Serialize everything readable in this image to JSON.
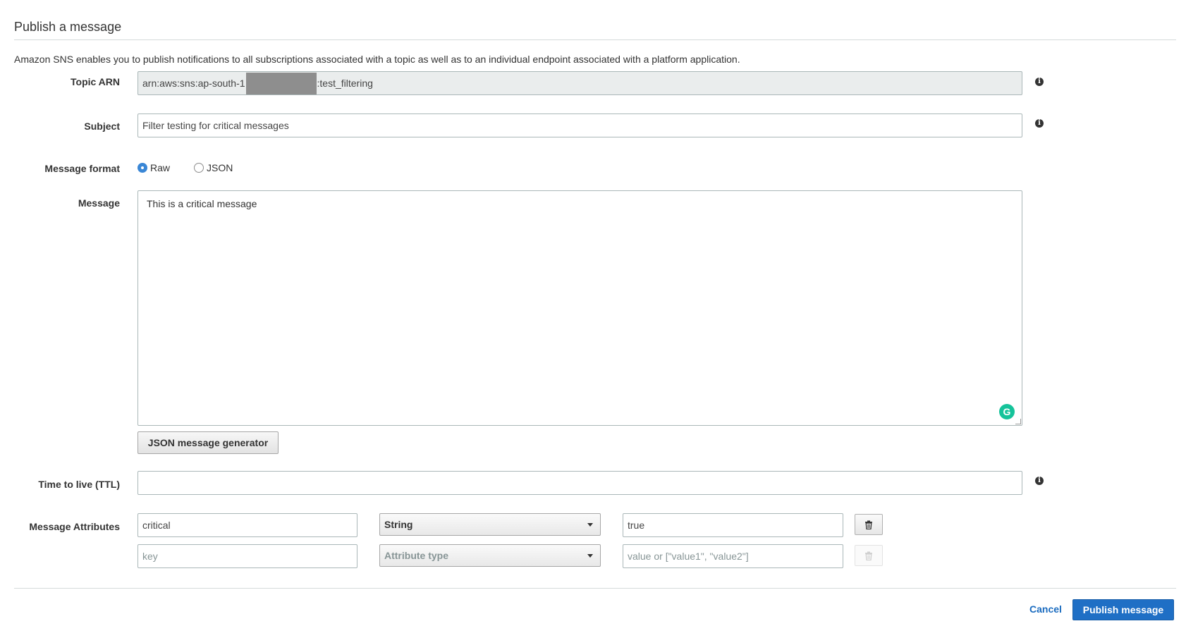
{
  "header": {
    "title": "Publish a message",
    "description": "Amazon SNS enables you to publish notifications to all subscriptions associated with a topic as well as to an individual endpoint associated with a platform application."
  },
  "form": {
    "topic_arn": {
      "label": "Topic ARN",
      "value_prefix": "arn:aws:sns:ap-south-1",
      "value_suffix": ":test_filtering"
    },
    "subject": {
      "label": "Subject",
      "value": "Filter testing for critical messages"
    },
    "message_format": {
      "label": "Message format",
      "options": [
        "Raw",
        "JSON"
      ],
      "selected": "Raw"
    },
    "message": {
      "label": "Message",
      "value": "This is a critical message"
    },
    "json_generator_label": "JSON message generator",
    "ttl": {
      "label": "Time to live (TTL)",
      "value": ""
    },
    "message_attributes": {
      "label": "Message Attributes",
      "rows": [
        {
          "key": "critical",
          "type": "String",
          "value": "true"
        },
        {
          "key_placeholder": "key",
          "type_placeholder": "Attribute type",
          "value_placeholder": "value or [\"value1\", \"value2\"]"
        }
      ]
    }
  },
  "footer": {
    "cancel_label": "Cancel",
    "publish_label": "Publish message"
  },
  "icons": {
    "info": "info-icon",
    "trash": "trash-icon",
    "grammarly": "grammarly-icon",
    "caret": "caret-down-icon"
  },
  "colors": {
    "primary": "#1f6fc5",
    "link": "#1a6bbf",
    "grammarly": "#15c39a"
  }
}
